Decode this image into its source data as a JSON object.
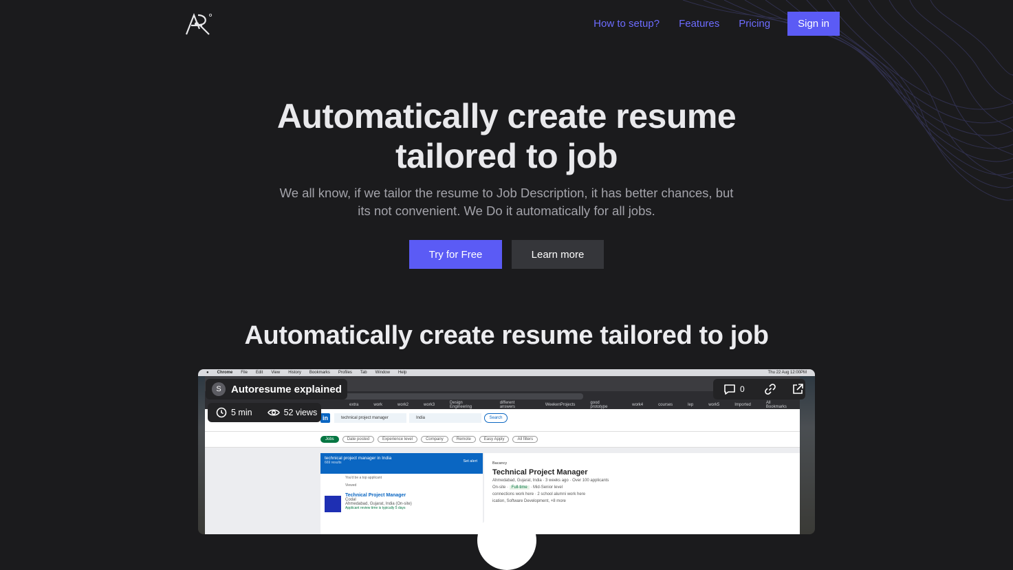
{
  "nav": {
    "links": [
      "How to setup?",
      "Features",
      "Pricing"
    ],
    "signin": "Sign in"
  },
  "hero": {
    "title_line1": "Automatically create resume",
    "title_line2": "tailored to job",
    "subtitle_line1": "We all know, if we tailor the resume to Job Description, it has better chances, but",
    "subtitle_line2": "its not convenient. We Do it automatically for all jobs.",
    "try_label": "Try for Free",
    "learn_label": "Learn more"
  },
  "section": {
    "title": "Automatically create resume tailored to job"
  },
  "video": {
    "avatar_letter": "S",
    "title": "Autoresume explained",
    "duration": "5 min",
    "views": "52 views",
    "comments": "0",
    "screen": {
      "menubar": [
        "Chrome",
        "File",
        "Edit",
        "View",
        "History",
        "Bookmarks",
        "Profiles",
        "Tab",
        "Window",
        "Help"
      ],
      "clock": "Thu 22 Aug 12:00PM",
      "bookmarks": [
        "extra",
        "work",
        "work2",
        "work3",
        "Design Engineering",
        "different answers",
        "WeekenProjects",
        "good prototype",
        "work4",
        "courses",
        "lep",
        "work5",
        "Imported"
      ],
      "all_bookmarks": "All Bookmarks",
      "search_value": "technical project manager",
      "location_value": "India",
      "search_button": "Search",
      "filters": [
        "Jobs",
        "Date posted",
        "Experience level",
        "Company",
        "Remote",
        "Easy Apply",
        "All filters"
      ],
      "list_title": "technical project manager in India",
      "list_count": "669 results",
      "set_alert": "Set alert",
      "top_applicant": "You'd be a top applicant",
      "viewed": "Viewed",
      "card_title": "Technical Project Manager",
      "card_company": "Codal",
      "card_location": "Ahmedabad, Gujarat, India (On-site)",
      "card_note": "Applicant review time is typically 5 days",
      "detail_company": "Bacancy",
      "detail_title": "Technical Project Manager",
      "detail_meta": "Ahmedabad, Gujarat, India · 3 weeks ago · Over 100 applicants",
      "detail_onsite": "On-site",
      "detail_fulltime": "Full-time",
      "detail_level": "Mid-Senior level",
      "detail_connections": "connections work here · 2 school alumni work here",
      "detail_skills": "ication, Software Development, +8 more"
    }
  },
  "colors": {
    "accent": "#5b5bf5",
    "link": "#6d6cff",
    "background": "#1b1b1d"
  }
}
